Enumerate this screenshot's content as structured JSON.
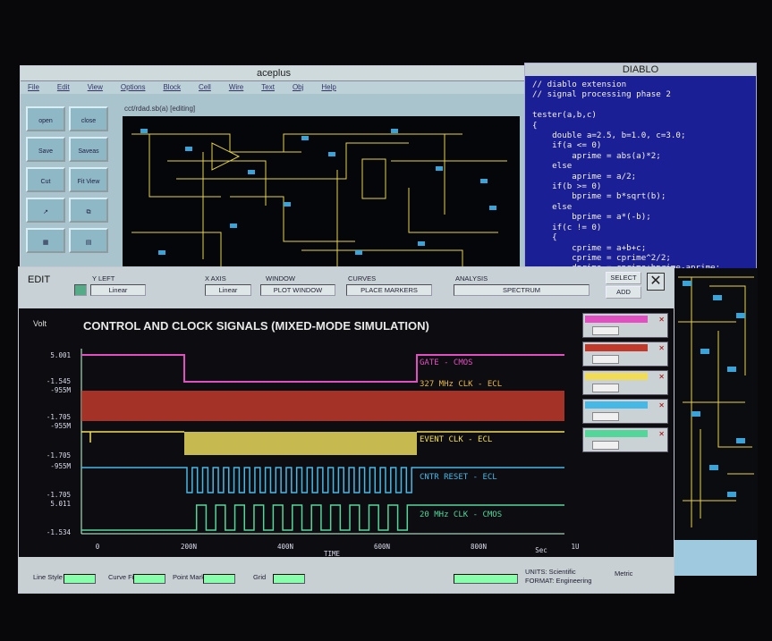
{
  "aceplus": {
    "title": "aceplus",
    "menu": [
      "File",
      "Edit",
      "View",
      "Options",
      "Block",
      "Cell",
      "Wire",
      "Text",
      "Obj",
      "Help"
    ],
    "tools": [
      "open",
      "close",
      "Save",
      "Saveas",
      "Cut",
      "Fit View",
      "",
      "",
      "",
      ""
    ],
    "path": "cct/rdad.sb(a) [editing]"
  },
  "diablo": {
    "title": "DIABLO",
    "code": "// diablo extension\n// signal processing phase 2\n\ntester(a,b,c)\n{\n    double a=2.5, b=1.0, c=3.0;\n    if(a <= 0)\n        aprime = abs(a)*2;\n    else\n        aprime = a/2;\n    if(b >= 0)\n        bprime = b*sqrt(b);\n    else\n        bprime = a*(-b);\n    if(c != 0)\n    {\n        cprime = a+b+c;\n        cprime = cprime^2/2;\n        dprime = cprime+bprime-aprime;"
  },
  "toolbar": {
    "edit": "EDIT",
    "yleft_label": "Y LEFT",
    "yleft_value": "Linear",
    "xaxis_label": "X AXIS",
    "xaxis_value": "Linear",
    "window_label": "WINDOW",
    "window_value": "PLOT WINDOW",
    "curves_label": "CURVES",
    "curves_value": "PLACE MARKERS",
    "analysis_label": "ANALYSIS",
    "analysis_value": "SPECTRUM",
    "select": "SELECT",
    "add": "ADD"
  },
  "plot": {
    "ylabel": "Volt",
    "title": "CONTROL AND CLOCK SIGNALS (MIXED-MODE SIMULATION)",
    "xlabel": "TIME",
    "xunit": "Sec",
    "yticks": [
      "5.001",
      "-1.545",
      "-955M",
      "-1.705",
      "-955M",
      "-1.705",
      "-955M",
      "-1.705",
      "5.011",
      "-1.534"
    ],
    "xticks": [
      "0",
      "200N",
      "400N",
      "600N",
      "800N",
      "1U"
    ],
    "signals": [
      {
        "name": "GATE - CMOS",
        "color": "#e24fc1"
      },
      {
        "name": "327 MHz CLK - ECL",
        "color": "#e6b64a"
      },
      {
        "name": "EVENT CLK - ECL",
        "color": "#f1dd55"
      },
      {
        "name": "CNTR RESET - ECL",
        "color": "#46b8e6"
      },
      {
        "name": "20 MHz CLK - CMOS",
        "color": "#54d69a"
      }
    ]
  },
  "legend": [
    "GATE",
    "327 MHz",
    "EVENT CLK",
    "CNTR",
    "20MHz"
  ],
  "bottom": {
    "line_style": "Line Style",
    "curve_fit": "Curve Fit",
    "point_marker": "Point Marker",
    "grid": "Grid",
    "units": "UNITS: Scientific",
    "format": "FORMAT: Engineering",
    "metric": "Metric"
  }
}
